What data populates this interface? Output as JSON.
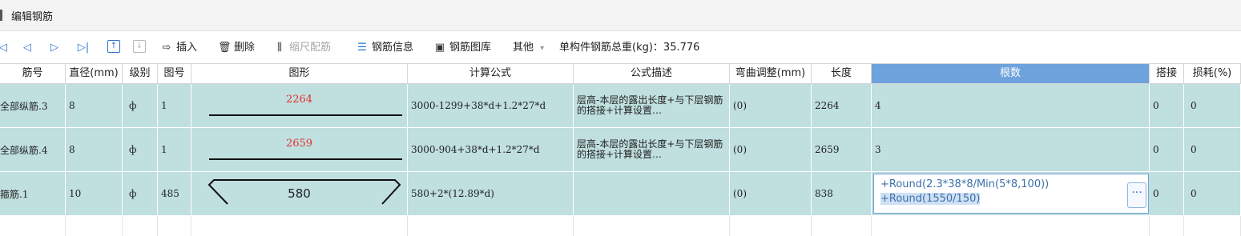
{
  "window": {
    "title": "编辑钢筋"
  },
  "toolbar": {
    "nav_icons": [
      "first-icon",
      "prev-icon",
      "next-icon",
      "last-icon"
    ],
    "move_up_icon": "move-up-icon",
    "move_down_icon": "move-down-icon",
    "insert_label": "插入",
    "delete_label": "删除",
    "scale_label": "缩尺配筋",
    "info_label": "钢筋信息",
    "library_label": "钢筋图库",
    "other_label": "其他",
    "other_arrow": "▾",
    "weight_text": "单构件钢筋总重(kg)：35.776"
  },
  "table": {
    "headers": [
      "筋号",
      "直径(mm)",
      "级别",
      "图号",
      "图形",
      "计算公式",
      "公式描述",
      "弯曲调整(mm)",
      "长度",
      "根数",
      "搭接",
      "损耗(%)"
    ],
    "rows": [
      {
        "name": "全部纵筋.3",
        "diameter": "8",
        "grade": "ф",
        "figure_no": "1",
        "shape_value": "2264",
        "formula": "3000-1299+38*d+1.2*27*d",
        "desc": "层高-本层的露出长度+与下层钢筋的搭接+计算设置…",
        "bend": "(0)",
        "length": "2264",
        "count": "4",
        "lap": "0",
        "loss": "0"
      },
      {
        "name": "全部纵筋.4",
        "diameter": "8",
        "grade": "ф",
        "figure_no": "1",
        "shape_value": "2659",
        "formula": "3000-904+38*d+1.2*27*d",
        "desc": "层高-本层的露出长度+与下层钢筋的搭接+计算设置…",
        "bend": "(0)",
        "length": "2659",
        "count": "3",
        "lap": "0",
        "loss": "0"
      },
      {
        "name": "箍筋.1",
        "diameter": "10",
        "grade": "ф",
        "figure_no": "485",
        "shape_value": "580",
        "formula": "580+2*(12.89*d)",
        "desc": "",
        "bend": "(0)",
        "length": "838",
        "count_line1": "+Round(2.3*38*8/Min(5*8,100))",
        "count_line2": "+Round(1550/150)",
        "lap": "0",
        "loss": "0"
      }
    ]
  }
}
